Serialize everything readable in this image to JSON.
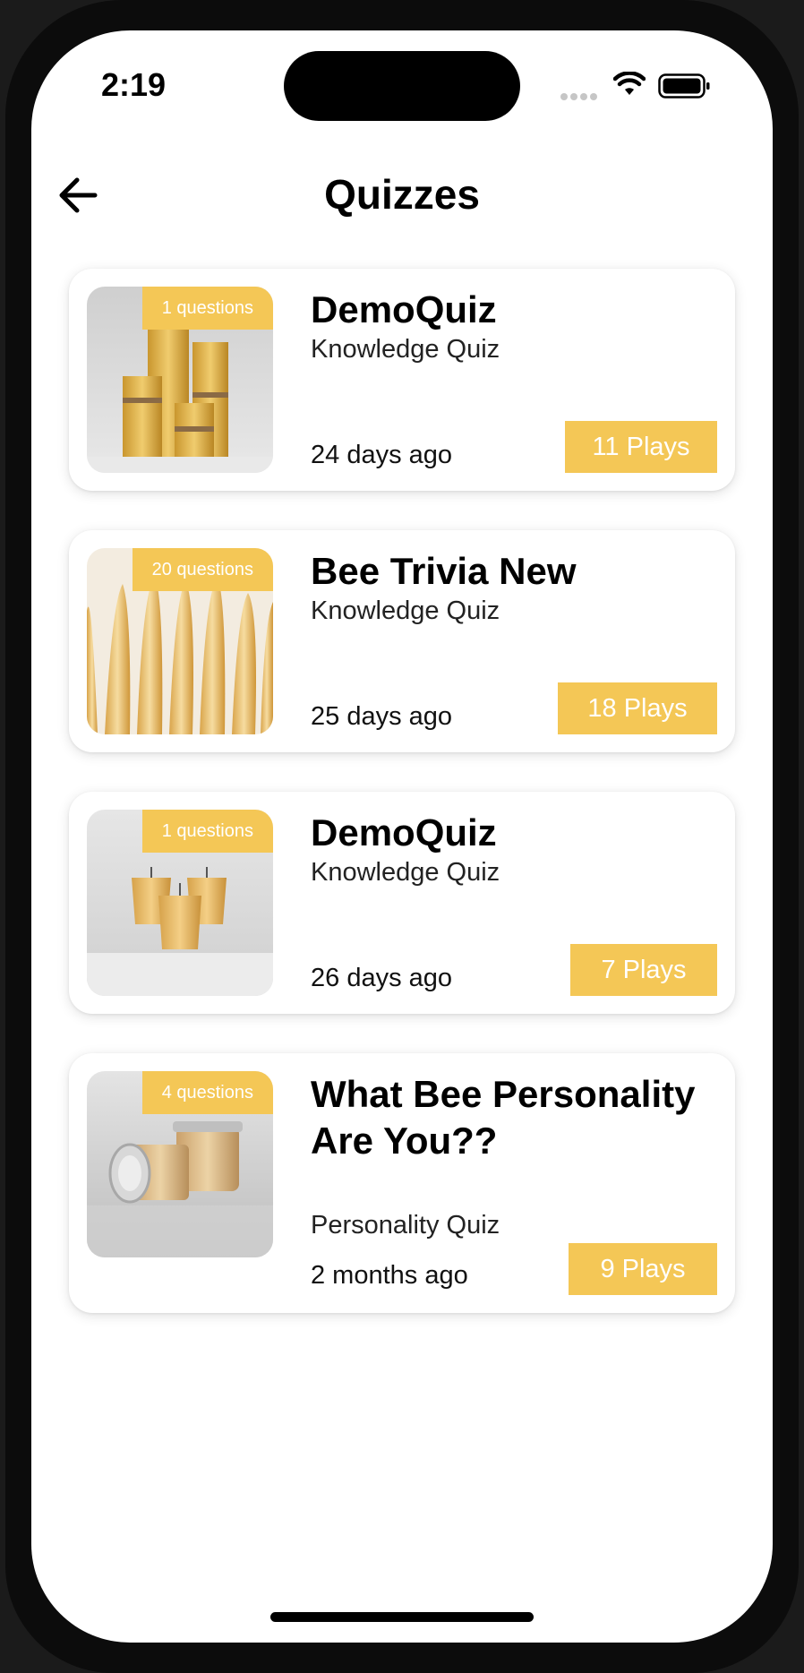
{
  "status_bar": {
    "time": "2:19"
  },
  "header": {
    "title": "Quizzes",
    "back_icon": "arrow-left-icon"
  },
  "colors": {
    "accent": "#f4c756",
    "background": "#ffffff",
    "text": "#000000"
  },
  "quizzes": [
    {
      "questions": "1 questions",
      "title": "DemoQuiz",
      "type": "Knowledge Quiz",
      "date": "24 days ago",
      "plays": "11 Plays",
      "image": "pillar-candles"
    },
    {
      "questions": "20 questions",
      "title": "Bee Trivia New",
      "type": "Knowledge Quiz",
      "date": "25 days ago",
      "plays": "18 Plays",
      "image": "taper-candles"
    },
    {
      "questions": "1 questions",
      "title": "DemoQuiz",
      "type": "Knowledge Quiz",
      "date": "26 days ago",
      "plays": "7 Plays",
      "image": "votive-candles"
    },
    {
      "questions": "4 questions",
      "title": "What Bee Personality Are You??",
      "type": "Personality Quiz",
      "date": "2 months ago",
      "plays": "9 Plays",
      "image": "jar-candles"
    }
  ]
}
